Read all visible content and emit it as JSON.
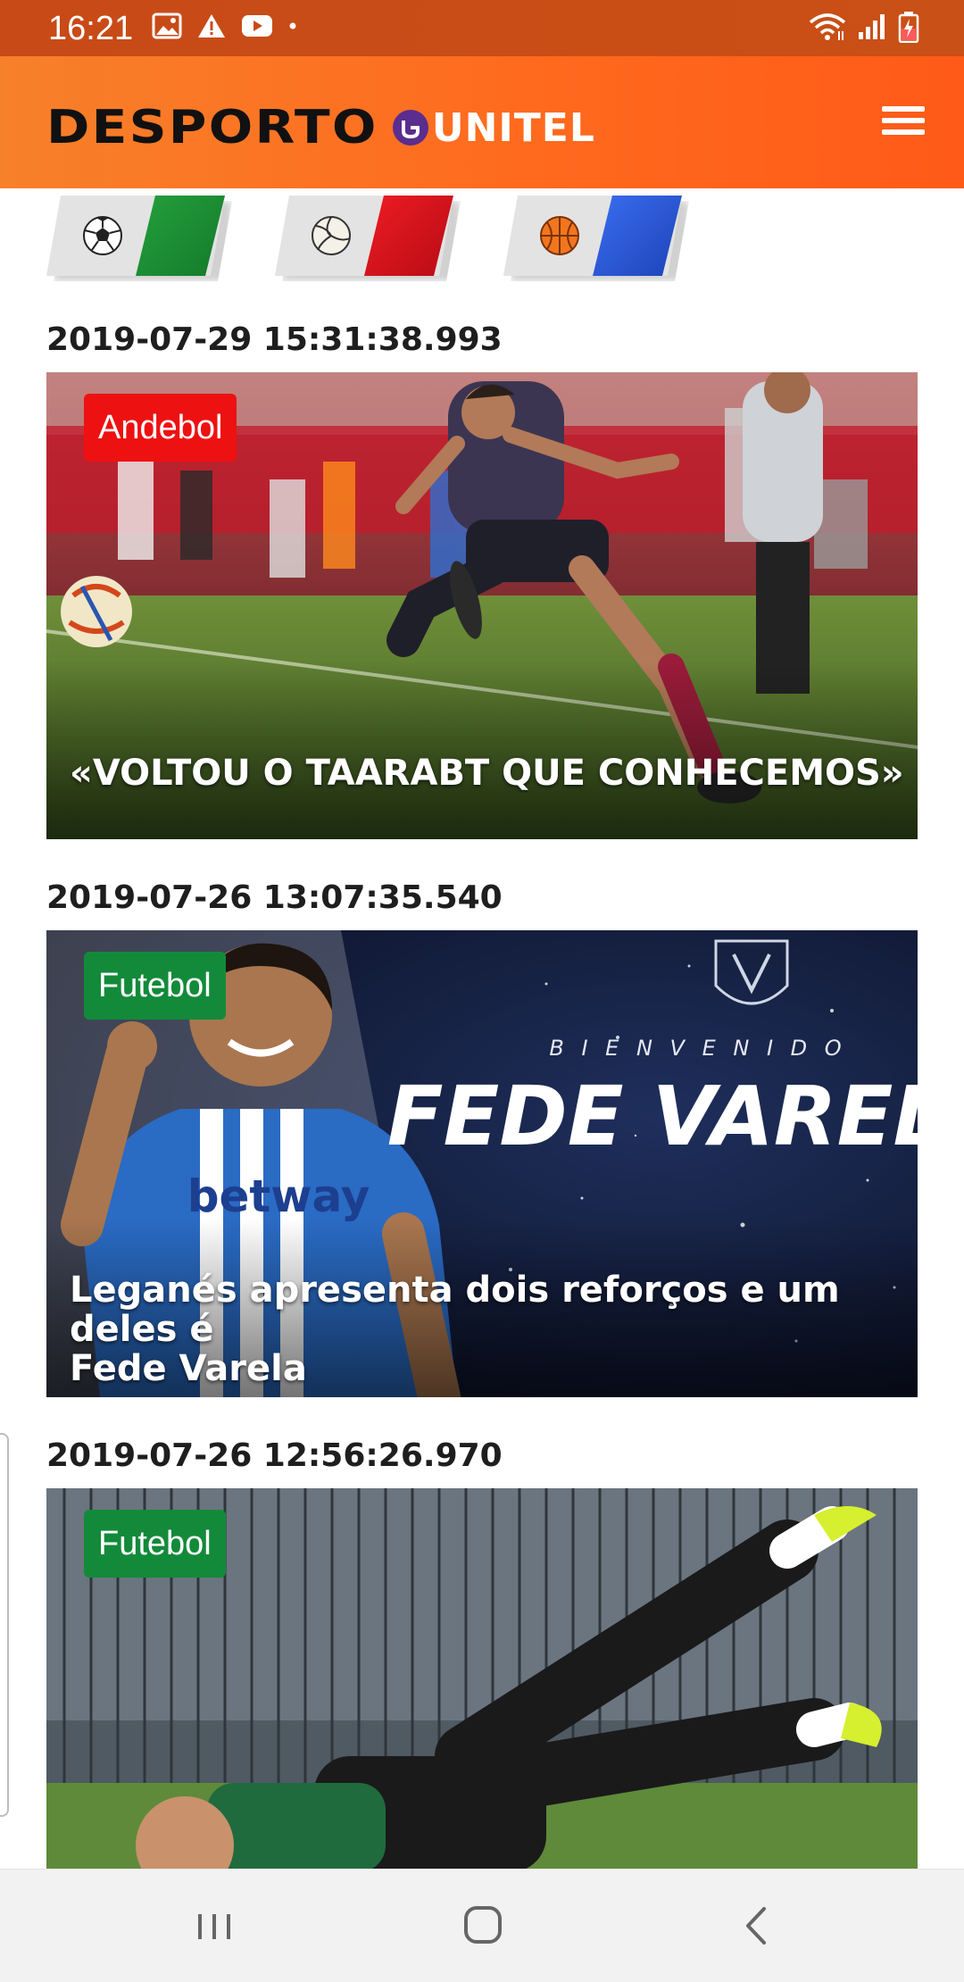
{
  "status_bar": {
    "time": "16:21",
    "left_icons": [
      "image-icon",
      "warning-icon",
      "youtube-icon",
      "dot-icon"
    ],
    "right_icons": [
      "wifi-icon",
      "signal-icon",
      "battery-charging-icon"
    ]
  },
  "header": {
    "brand_primary": "DESPORTO",
    "brand_secondary": "UNITEL",
    "menu_icon": "hamburger-menu-icon"
  },
  "sport_tabs": [
    {
      "sport": "soccer-ball-icon",
      "color": "#1a8a2e"
    },
    {
      "sport": "volleyball-icon",
      "color": "#d90e1a"
    },
    {
      "sport": "basketball-icon",
      "color": "#2a57d4"
    }
  ],
  "news": [
    {
      "date": "2019-07-29 15:31:38.993",
      "category": "Andebol",
      "category_color": "#ee1111",
      "title": "«VOLTOU O TAARABT QUE CONHECEMOS»"
    },
    {
      "date": "2019-07-26 13:07:35.540",
      "category": "Futebol",
      "category_color": "#138a3a",
      "title": "Leganés apresenta dois reforços e um deles é\nFede Varela",
      "image_text_small": "B I E N V E N I D O",
      "image_text_big": "FEDE VARELA",
      "image_jersey_text": "betway"
    },
    {
      "date": "2019-07-26 12:56:26.970",
      "category": "Futebol",
      "category_color": "#138a3a",
      "title": ""
    }
  ],
  "nav_bar": {
    "buttons": [
      "recent-apps-icon",
      "home-icon",
      "back-icon"
    ]
  }
}
